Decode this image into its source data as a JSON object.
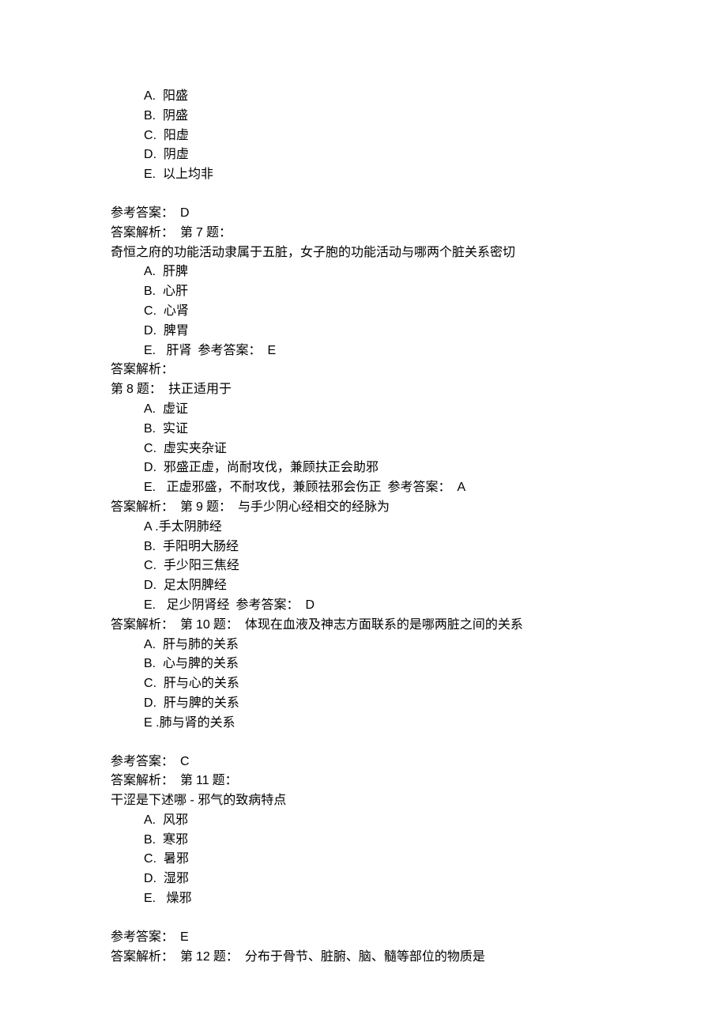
{
  "q6_options": {
    "A": "阳盛",
    "B": "阴盛",
    "C": "阳虚",
    "D": "阴虚",
    "E": "以上均非"
  },
  "q6_answer_label": "参考答案：",
  "q6_answer": "D",
  "q6_analysis_label": "答案解析：",
  "q7_label": "第",
  "q7_num": "7",
  "q7_suffix": "题：",
  "q7_text": "奇恒之府的功能活动隶属于五脏，女子胞的功能活动与哪两个脏关系密切",
  "q7_options": {
    "A": "肝脾",
    "B": "心肝",
    "C": "心肾",
    "D": "脾胃",
    "E": "肝肾"
  },
  "q7_inline_answer_label": "参考答案：",
  "q7_inline_answer": "E",
  "q7_analysis_label": "答案解析：",
  "q8_label": "第",
  "q8_num": "8",
  "q8_suffix": "题：",
  "q8_text": "扶正适用于",
  "q8_options": {
    "A": "虚证",
    "B": "实证",
    "C": "虚实夹杂证",
    "D": "邪盛正虚，尚耐攻伐，兼顾扶正会助邪",
    "E": "正虚邪盛，不耐攻伐，兼顾祛邪会伤正"
  },
  "q8_inline_answer_label": "参考答案：",
  "q8_inline_answer": "A",
  "q8_analysis_label": "答案解析：",
  "q9_label": "第",
  "q9_num": "9",
  "q9_suffix": "题：",
  "q9_text": "与手少阴心经相交的经脉为",
  "q9_options": {
    "A": "手太阴肺经",
    "B": "手阳明大肠经",
    "C": "手少阳三焦经",
    "D": "足太阴脾经",
    "E": "足少阴肾经"
  },
  "q9_inline_answer_label": "参考答案：",
  "q9_inline_answer": "D",
  "q9_analysis_label": "答案解析：",
  "q10_label": "第",
  "q10_num": "10",
  "q10_suffix": "题：",
  "q10_text": "体现在血液及神志方面联系的是哪两脏之间的关系",
  "q10_options": {
    "A": "肝与肺的关系",
    "B": "心与脾的关系",
    "C": "肝与心的关系",
    "D": "肝与脾的关系",
    "E": "肺与肾的关系"
  },
  "q10_answer_label": "参考答案：",
  "q10_answer": "C",
  "q10_analysis_label": "答案解析：",
  "q11_label": "第",
  "q11_num": "11",
  "q11_suffix": "题：",
  "q11_text_p1": "干涩是下述哪",
  "q11_text_sep": " - ",
  "q11_text_p2": "邪气的致病特点",
  "q11_options": {
    "A": "风邪",
    "B": "寒邪",
    "C": "暑邪",
    "D": "湿邪",
    "E": "燥邪"
  },
  "q11_answer_label": "参考答案：",
  "q11_answer": "E",
  "q11_analysis_label": "答案解析：",
  "q12_label": "第",
  "q12_num": "12",
  "q12_suffix": "题：",
  "q12_text": "分布于骨节、脏腑、脑、髓等部位的物质是",
  "dot_space": ".  ",
  "dot_space2": ".   ",
  "opt_prefix": {
    "A": "A",
    "B": "B",
    "C": "C",
    "D": "D",
    "E": "E"
  }
}
